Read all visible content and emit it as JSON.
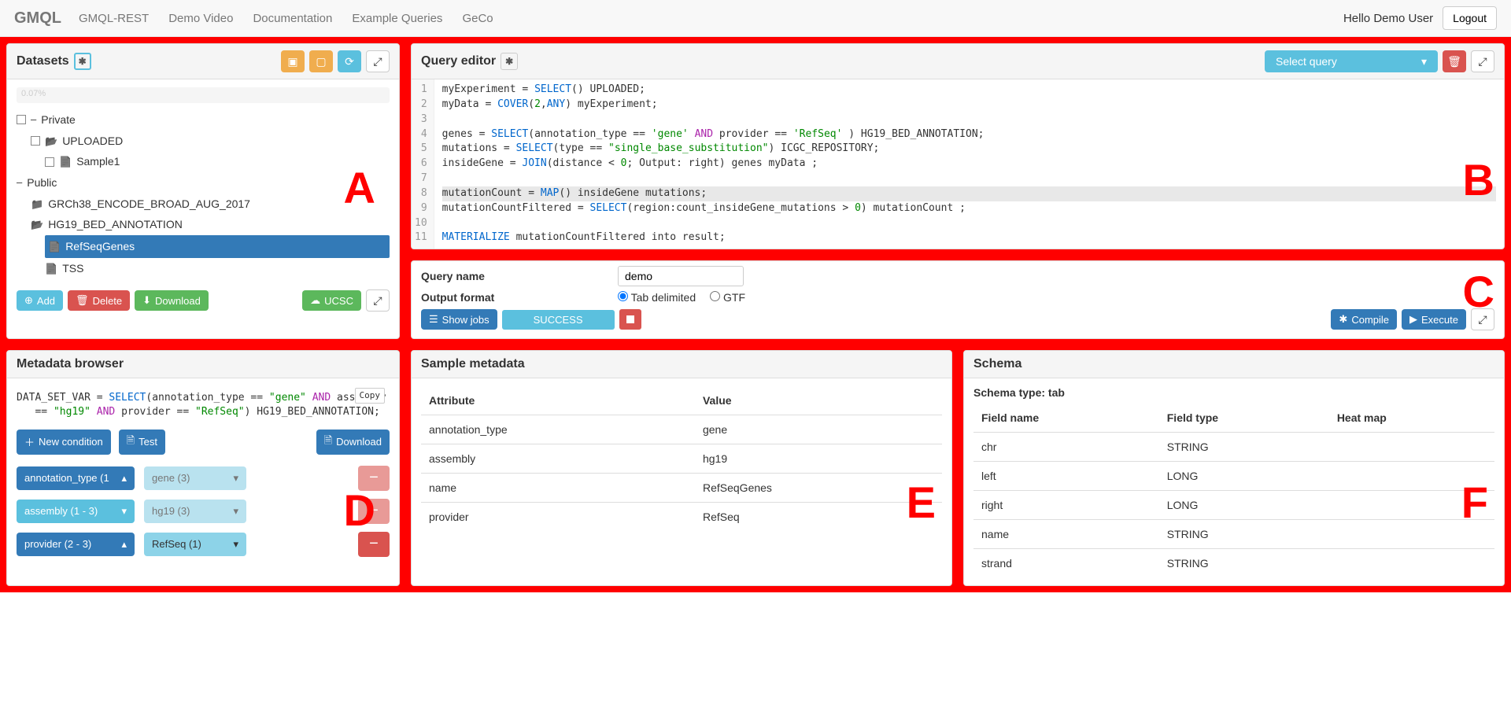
{
  "nav": {
    "brand": "GMQL",
    "items": [
      "GMQL-REST",
      "Demo Video",
      "Documentation",
      "Example Queries",
      "GeCo"
    ],
    "greet": "Hello Demo User",
    "logout": "Logout"
  },
  "datasets": {
    "title": "Datasets",
    "progress": "0.07%",
    "private_label": "Private",
    "uploaded": "UPLOADED",
    "sample1": "Sample1",
    "public_label": "Public",
    "ds1": "GRCh38_ENCODE_BROAD_AUG_2017",
    "ds2": "HG19_BED_ANNOTATION",
    "ds2a": "RefSeqGenes",
    "ds2b": "TSS",
    "add": "Add",
    "delete": "Delete",
    "download": "Download",
    "ucsc": "UCSC"
  },
  "editor": {
    "title": "Query editor",
    "select_query": "Select query",
    "lines": [
      "1",
      "2",
      "3",
      "4",
      "5",
      "6",
      "7",
      "8",
      "9",
      "10",
      "11"
    ]
  },
  "qc": {
    "name_label": "Query name",
    "name_value": "demo",
    "format_label": "Output format",
    "fmt_tab": "Tab delimited",
    "fmt_gtf": "GTF",
    "show_jobs": "Show   jobs",
    "status": "SUCCESS",
    "compile": "Compile",
    "execute": "Execute"
  },
  "mb": {
    "title": "Metadata browser",
    "copy": "Copy",
    "new_cond": "New condition",
    "test": "Test",
    "download": "Download",
    "cond1_key": "annotation_type (1",
    "cond1_val": "gene (3)",
    "cond2_key": "assembly (1 - 3)",
    "cond2_val": "hg19 (3)",
    "cond3_key": "provider (2 - 3)",
    "cond3_val": "RefSeq (1)"
  },
  "sample": {
    "title": "Sample metadata",
    "h1": "Attribute",
    "h2": "Value",
    "r1a": "annotation_type",
    "r1b": "gene",
    "r2a": "assembly",
    "r2b": "hg19",
    "r3a": "name",
    "r3b": "RefSeqGenes",
    "r4a": "provider",
    "r4b": "RefSeq"
  },
  "schema": {
    "title": "Schema",
    "type_label": "Schema type: tab",
    "h1": "Field name",
    "h2": "Field type",
    "h3": "Heat map",
    "r1a": "chr",
    "r1b": "STRING",
    "r2a": "left",
    "r2b": "LONG",
    "r3a": "right",
    "r3b": "LONG",
    "r4a": "name",
    "r4b": "STRING",
    "r5a": "strand",
    "r5b": "STRING"
  },
  "letters": {
    "A": "A",
    "B": "B",
    "C": "C",
    "D": "D",
    "E": "E",
    "F": "F"
  }
}
